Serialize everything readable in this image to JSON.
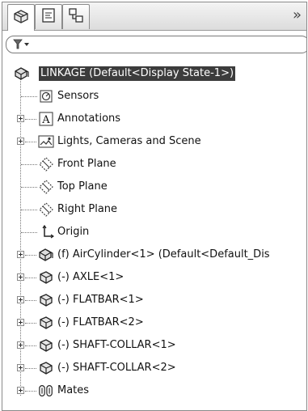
{
  "tabs": [
    {
      "name": "featuremanager",
      "icon": "part-tree-icon"
    },
    {
      "name": "propertymanager",
      "icon": "property-manager-icon"
    },
    {
      "name": "configurationmanager",
      "icon": "configuration-manager-icon"
    }
  ],
  "overflow_icon": "double-chevron-right-icon",
  "filter": {
    "icon": "filter-icon",
    "value": ""
  },
  "tree": {
    "root": {
      "label": "LINKAGE  (Default<Display State-1>)",
      "icon": "assembly-icon",
      "selected": true
    },
    "items": [
      {
        "label": "Sensors",
        "icon": "sensors-icon",
        "expandable": false
      },
      {
        "label": "Annotations",
        "icon": "annotations-icon",
        "expandable": true
      },
      {
        "label": "Lights, Cameras and Scene",
        "icon": "lights-cameras-icon",
        "expandable": true
      },
      {
        "label": "Front Plane",
        "icon": "plane-icon",
        "expandable": false
      },
      {
        "label": "Top Plane",
        "icon": "plane-icon",
        "expandable": false
      },
      {
        "label": "Right Plane",
        "icon": "plane-icon",
        "expandable": false
      },
      {
        "label": "Origin",
        "icon": "origin-icon",
        "expandable": false
      },
      {
        "label": "(f) AirCylinder<1> (Default<Default_Dis",
        "icon": "subassembly-icon",
        "expandable": true
      },
      {
        "label": "(-) AXLE<1>",
        "icon": "part-icon",
        "expandable": true
      },
      {
        "label": "(-) FLATBAR<1>",
        "icon": "part-icon",
        "expandable": true
      },
      {
        "label": "(-) FLATBAR<2>",
        "icon": "part-icon",
        "expandable": true
      },
      {
        "label": "(-) SHAFT-COLLAR<1>",
        "icon": "part-icon",
        "expandable": true
      },
      {
        "label": "(-) SHAFT-COLLAR<2>",
        "icon": "part-icon",
        "expandable": true
      },
      {
        "label": "Mates",
        "icon": "mates-icon",
        "expandable": true
      }
    ]
  }
}
